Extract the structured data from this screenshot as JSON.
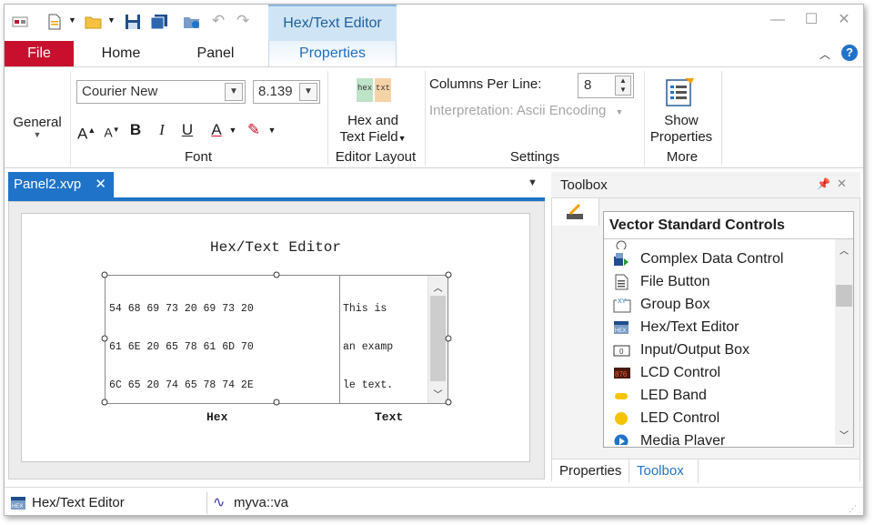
{
  "tabs": {
    "file": "File",
    "home": "Home",
    "panel": "Panel",
    "properties": "Properties"
  },
  "context_tab_group": "Hex/Text Editor",
  "ribbon": {
    "general": "General",
    "font_name": "Courier New",
    "font_size": "8.139",
    "font_group": "Font",
    "hex_and_text_line1": "Hex and",
    "hex_and_text_line2": "Text Field",
    "editor_layout": "Editor Layout",
    "columns_label": "Columns Per Line:",
    "columns_value": "8",
    "interpretation": "Interpretation: Ascii Encoding",
    "settings": "Settings",
    "show_props_line1": "Show",
    "show_props_line2": "Properties",
    "more": "More",
    "hex_icon_left": "hex",
    "hex_icon_right": "txt"
  },
  "document": {
    "tab_label": "Panel2.xvp",
    "close_glyph": "✕",
    "control_title": "Hex/Text Editor",
    "hex_lines": [
      "54 68 69 73 20 69 73 20",
      "61 6E 20 65 78 61 6D 70",
      "6C 65 20 74 65 78 74 2E"
    ],
    "text_lines": [
      "This is",
      "an examp",
      "le text."
    ],
    "hex_caption": "Hex",
    "text_caption": "Text"
  },
  "toolbox": {
    "title": "Toolbox",
    "category": "Vector Standard Controls",
    "items": [
      {
        "label": "Complex Data Control",
        "icon": "complex-data-icon"
      },
      {
        "label": "File Button",
        "icon": "file-button-icon"
      },
      {
        "label": "Group Box",
        "icon": "group-box-icon"
      },
      {
        "label": "Hex/Text Editor",
        "icon": "hex-editor-icon"
      },
      {
        "label": "Input/Output Box",
        "icon": "io-box-icon"
      },
      {
        "label": "LCD Control",
        "icon": "lcd-icon"
      },
      {
        "label": "LED Band",
        "icon": "led-band-icon"
      },
      {
        "label": "LED Control",
        "icon": "led-control-icon"
      },
      {
        "label": "Media Player",
        "icon": "media-player-icon"
      }
    ],
    "bottom_tab_properties": "Properties",
    "bottom_tab_toolbox": "Toolbox"
  },
  "status": {
    "item1": "Hex/Text Editor",
    "item2": "myva::va"
  },
  "colors": {
    "file_tab": "#c8102e",
    "accent": "#1f73c8",
    "context_group": "#cfe4f5"
  }
}
